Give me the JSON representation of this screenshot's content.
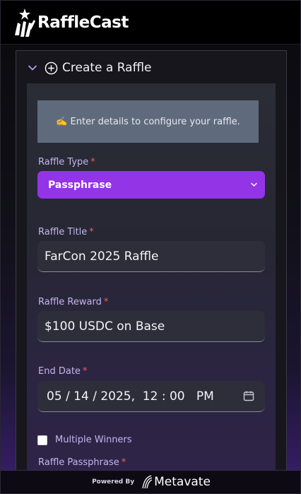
{
  "app": {
    "brand": "RaffleCast"
  },
  "panel": {
    "title": "Create a Raffle",
    "info_text": "✍️ Enter details to configure your raffle."
  },
  "form": {
    "raffle_type": {
      "label": "Raffle Type",
      "required": "*",
      "value": "Passphrase"
    },
    "raffle_title": {
      "label": "Raffle Title",
      "required": "*",
      "value": "FarCon 2025 Raffle"
    },
    "raffle_reward": {
      "label": "Raffle Reward",
      "required": "*",
      "value": "$100 USDC on Base"
    },
    "end_date": {
      "label": "End Date",
      "required": "*",
      "value": "05 / 14 / 2025,  12 : 00   PM"
    },
    "multiple_winners": {
      "label": "Multiple Winners",
      "checked": false
    },
    "raffle_passphrase": {
      "label": "Raffle Passphrase",
      "required": "*"
    }
  },
  "footer": {
    "powered_by": "Powered By",
    "partner": "Metavate"
  },
  "colors": {
    "accent": "#9334e6",
    "label": "#c6b5ee",
    "required": "#ef5a5a",
    "info_bg": "#5f6b7c"
  },
  "icons": {
    "logo": "raffle-logo-icon",
    "chevron": "chevron-down-icon",
    "add": "plus-circle-icon",
    "select_caret": "chevron-down-icon",
    "calendar": "calendar-icon",
    "partner_logo": "metavate-logo-icon"
  }
}
